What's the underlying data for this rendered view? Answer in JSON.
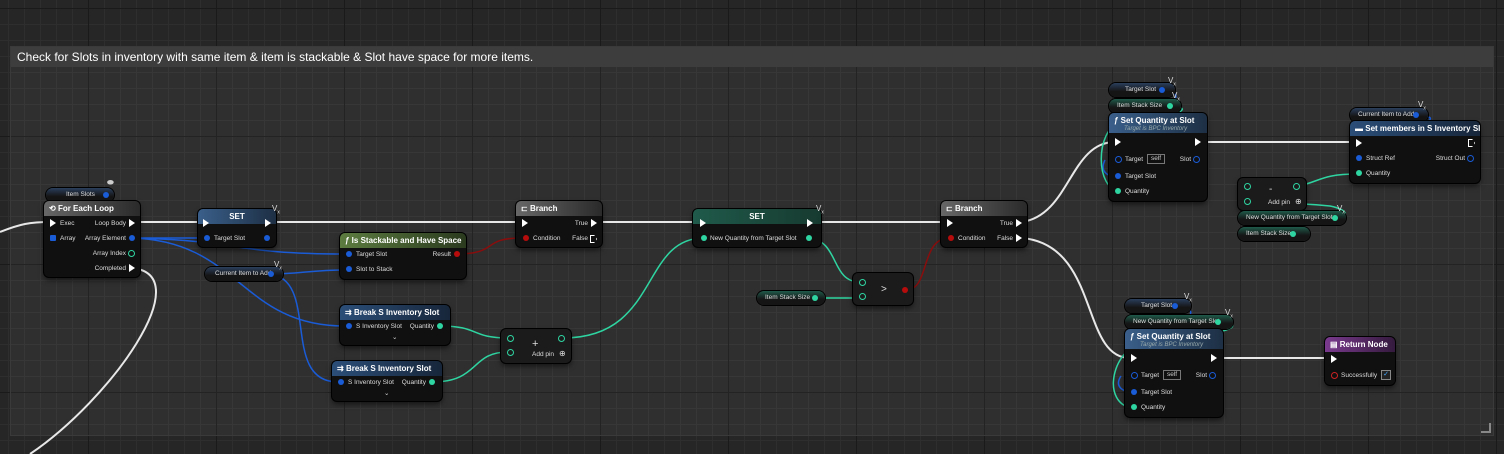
{
  "comment": {
    "title": "Check for Slots in inventory with same item & item is stackable & Slot have space for more items."
  },
  "nodes": {
    "item_slots": "Item Slots",
    "for_each": {
      "title": "For Each Loop",
      "exec": "Exec",
      "array": "Array",
      "loop_body": "Loop Body",
      "array_element": "Array Element",
      "array_index": "Array Index",
      "completed": "Completed"
    },
    "set1": {
      "title": "SET",
      "target_slot": "Target Slot"
    },
    "current_item_1": "Current Item to Add",
    "is_stackable": {
      "title": "Is Stackable and Have Space",
      "target_slot": "Target Slot",
      "slot_to_stack": "Slot to Stack",
      "result": "Result"
    },
    "branch1": {
      "title": "Branch",
      "condition": "Condition",
      "true": "True",
      "false": "False"
    },
    "break1": {
      "title": "Break S Inventory Slot",
      "in": "S Inventory Slot",
      "out": "Quantity"
    },
    "break2": {
      "title": "Break S Inventory Slot",
      "in": "S Inventory Slot",
      "out": "Quantity"
    },
    "add1": {
      "symbol": "+",
      "add_pin": "Add pin"
    },
    "set2": {
      "title": "SET",
      "new_qty": "New Quantity from Target Slot"
    },
    "item_stack_size_1": "Item Stack Size",
    "greater": {
      "symbol": ">"
    },
    "branch2": {
      "title": "Branch",
      "condition": "Condition",
      "true": "True",
      "false": "False"
    },
    "target_slot_var_1": "Target Slot",
    "item_stack_size_2": "Item Stack Size",
    "set_qty_1": {
      "title": "Set Quantity at Slot",
      "subtitle": "Target is BPC Inventory",
      "target": "Target",
      "self": "self",
      "slot": "Slot",
      "target_slot": "Target Slot",
      "quantity": "Quantity"
    },
    "current_item_2": "Current Item to Add",
    "set_members": {
      "title": "Set members in S Inventory Slot",
      "struct_ref": "Struct Ref",
      "struct_out": "Struct Out",
      "quantity": "Quantity"
    },
    "sub1": {
      "symbol": "-",
      "add_pin": "Add pin"
    },
    "new_qty_var_1": "New Quantity from Target Slot",
    "item_stack_size_3": "Item Stack Size",
    "target_slot_var_2": "Target Slot",
    "new_qty_var_2": "New Quantity from Target Slot",
    "set_qty_2": {
      "title": "Set Quantity at Slot",
      "subtitle": "Target is BPC Inventory",
      "target": "Target",
      "self": "self",
      "slot": "Slot",
      "target_slot": "Target Slot",
      "quantity": "Quantity"
    },
    "return_node": {
      "title": "Return Node",
      "successfully": "Successfully"
    }
  },
  "colors": {
    "exec": "#ffffff",
    "object": "#1a5bd6",
    "integer": "#2fd5a1",
    "bool": "#b70c0c",
    "struct": "#1a5bd6"
  }
}
